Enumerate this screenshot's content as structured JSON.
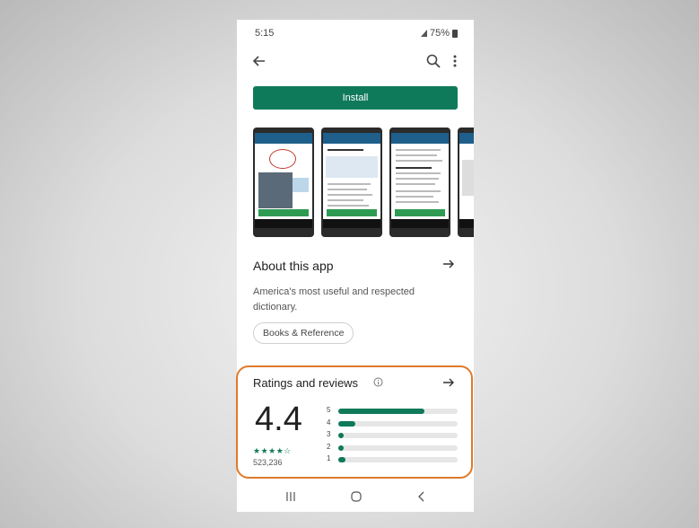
{
  "status": {
    "time": "5:15",
    "battery": "75%"
  },
  "install": {
    "label": "Install"
  },
  "about": {
    "title": "About this app",
    "description": "America's most useful and respected dictionary.",
    "category_chip": "Books & Reference"
  },
  "ratings": {
    "title": "Ratings and reviews",
    "score": "4.4",
    "stars": "★★★★☆",
    "count": "523,236",
    "distribution": [
      {
        "star": "5",
        "fraction": 0.72
      },
      {
        "star": "4",
        "fraction": 0.14
      },
      {
        "star": "3",
        "fraction": 0.04
      },
      {
        "star": "2",
        "fraction": 0.03
      },
      {
        "star": "1",
        "fraction": 0.06
      }
    ]
  },
  "colors": {
    "accent": "#0f7a5a",
    "highlight": "#e07a2c"
  },
  "icons": {
    "back": "back-arrow-icon",
    "search": "search-icon",
    "more": "more-vert-icon",
    "about_arrow": "arrow-right-icon",
    "info": "info-icon",
    "nav_recent": "recent-apps-icon",
    "nav_home": "home-icon",
    "nav_back": "nav-back-icon"
  }
}
